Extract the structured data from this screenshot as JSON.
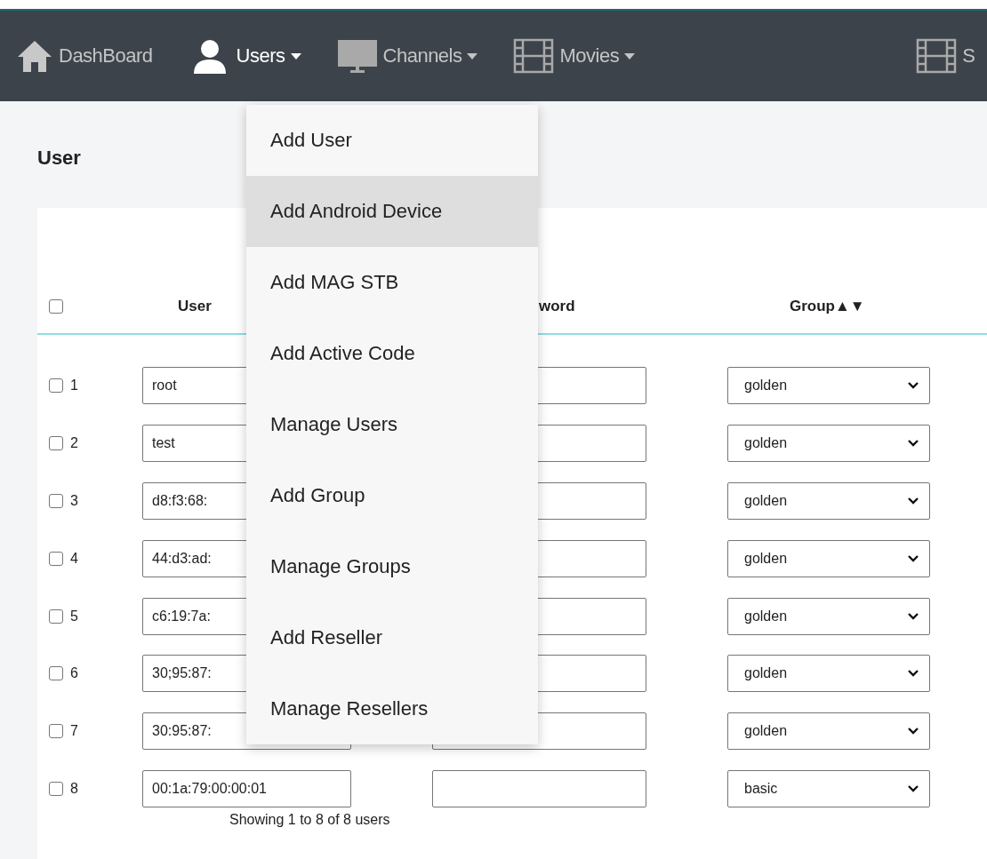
{
  "nav": {
    "items": [
      {
        "kind": "home",
        "label": "DashBoard",
        "dropdown": false,
        "selected": false
      },
      {
        "kind": "user",
        "label": "Users",
        "dropdown": true,
        "selected": true
      },
      {
        "kind": "monitor",
        "label": "Channels",
        "dropdown": true,
        "selected": false
      },
      {
        "kind": "film",
        "label": "Movies",
        "dropdown": true,
        "selected": false
      },
      {
        "kind": "film",
        "label": "S",
        "dropdown": false,
        "selected": false
      }
    ]
  },
  "menu": {
    "items": [
      {
        "label": "Add User",
        "selected": false
      },
      {
        "label": "Add Android Device",
        "selected": true
      },
      {
        "label": "Add MAG STB",
        "selected": false
      },
      {
        "label": "Add Active Code",
        "selected": false
      },
      {
        "label": "Manage Users",
        "selected": false
      },
      {
        "label": "Add Group",
        "selected": false
      },
      {
        "label": "Manage Groups",
        "selected": false
      },
      {
        "label": "Add Reseller",
        "selected": false
      },
      {
        "label": "Manage Resellers",
        "selected": false
      }
    ]
  },
  "page_title": "User",
  "table": {
    "select_all": {
      "checked": false
    },
    "columns": [
      "User",
      "word",
      "Group▲▼"
    ],
    "rows": [
      {
        "checked": false,
        "number": "1",
        "user_id": "root",
        "group": "golden"
      },
      {
        "checked": false,
        "number": "2",
        "user_id": "test",
        "group": "golden"
      },
      {
        "checked": false,
        "number": "3",
        "user_id": "d8:f3:68:",
        "group": "golden"
      },
      {
        "checked": false,
        "number": "4",
        "user_id": "44:d3:ad:",
        "group": "golden"
      },
      {
        "checked": false,
        "number": "5",
        "user_id": "c6:19:7a:",
        "group": "golden"
      },
      {
        "checked": false,
        "number": "6",
        "user_id": "30;95:87:",
        "group": "golden"
      },
      {
        "checked": false,
        "number": "7",
        "user_id": "30:95:87:",
        "group": "golden"
      },
      {
        "checked": false,
        "number": "8",
        "user_id": "00:1a:79:00:00:01",
        "group": "basic"
      }
    ],
    "footer": "Showing 1 to 8 of 8 users"
  }
}
